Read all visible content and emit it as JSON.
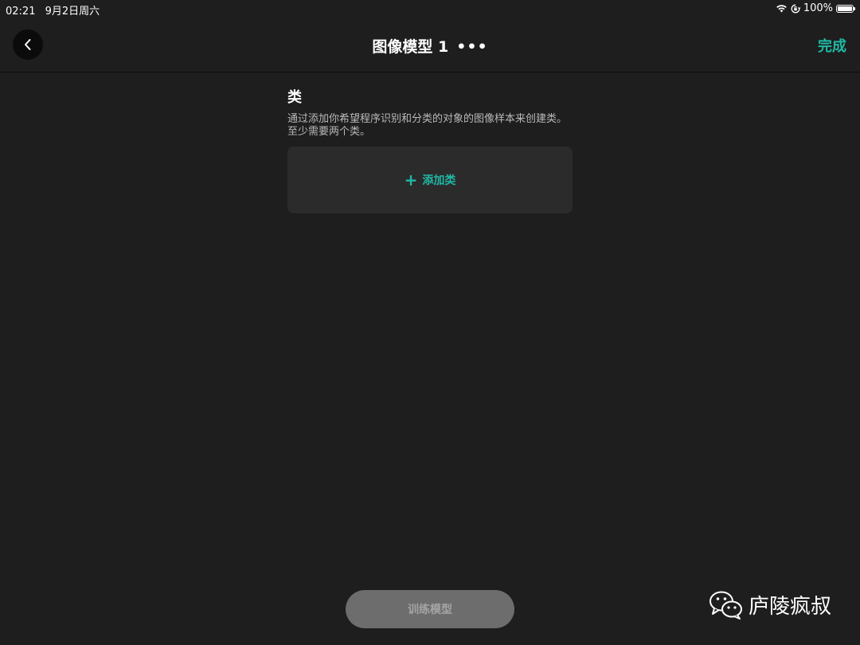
{
  "status_bar": {
    "time": "02:21",
    "date": "9月2日周六",
    "battery": "100%",
    "wifi_icon": "wifi-icon",
    "orientation_lock_icon": "orientation-lock-icon"
  },
  "nav": {
    "back_icon": "chevron-left-icon",
    "title": "图像模型 1",
    "more": "•••",
    "done": "完成"
  },
  "classes_section": {
    "title": "类",
    "description": "通过添加你希望程序识别和分类的对象的图像样本来创建类。至少需要两个类。",
    "add_button": {
      "icon": "+",
      "label": "添加类"
    }
  },
  "footer": {
    "train_button": "训练模型"
  },
  "watermark": {
    "icon": "wechat-icon",
    "text": "庐陵疯叔"
  },
  "colors": {
    "accent": "#1fb9a4",
    "background": "#1e1e1e",
    "card": "#2b2b2b",
    "disabled_button": "#6d6d6d"
  }
}
